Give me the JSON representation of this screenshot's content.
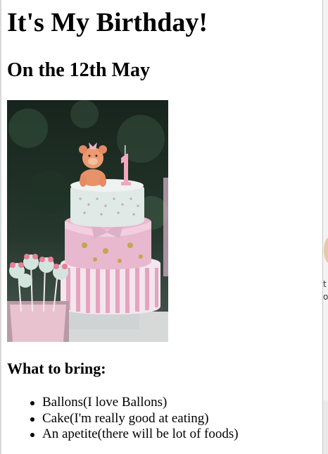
{
  "page": {
    "title": "It's My Birthday!",
    "subtitle": "On the 12th May",
    "image": {
      "alt": "Pink and white tiered birthday cake with a teddy bear topper and a number 1 candle"
    },
    "bring_heading": "What to bring:",
    "bring_items": [
      "Ballons(I love Ballons)",
      "Cake(I'm really good at eating)",
      "An apetite(there will be lot of foods)"
    ]
  },
  "background_window": {
    "text_fragment": "t\no"
  },
  "colors": {
    "text": "#000000",
    "background": "#ffffff",
    "cake_pink": "#e8b8cf",
    "cake_mint": "#d8e7e3"
  }
}
